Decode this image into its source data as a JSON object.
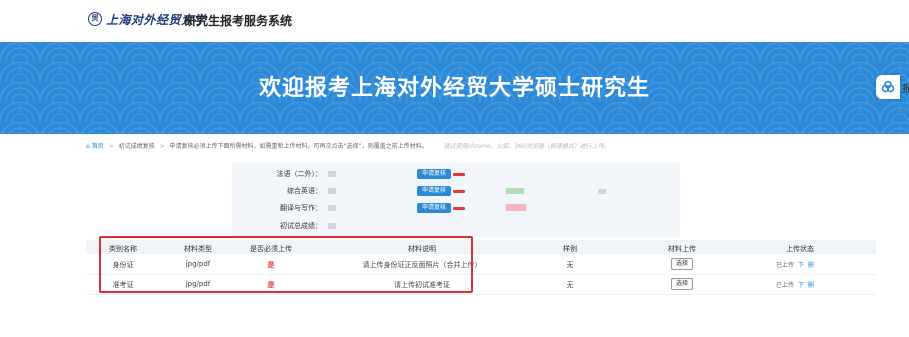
{
  "header": {
    "logo_seal": "贸",
    "logo_name": "上海对外经贸大学",
    "system_title": "研究生报考服务系统"
  },
  "banner": {
    "title": "欢迎报考上海对外经贸大学硕士研究生",
    "bg_color": "#2c89d8"
  },
  "float_button": {
    "icon": "cloud-icon",
    "label": "报"
  },
  "breadcrumb": {
    "home": "首页",
    "current": "初试成绩复核",
    "instruction": "申请复核必须上传下面所需材料，如需重新上传材料，可再次点击“选择”，则覆盖之前上传材料。",
    "tip": "建议使用chrome、火狐、360浏览器（极速模式）进行上传。"
  },
  "scores": [
    {
      "label": "法语（二外）：",
      "button": "申请复核"
    },
    {
      "label": "综合英语：",
      "button": "申请复核"
    },
    {
      "label": "翻译与写作：",
      "button": "申请复核"
    },
    {
      "label": "初试总成绩："
    }
  ],
  "table": {
    "headers": [
      "类别名称",
      "材料类型",
      "是否必须上传",
      "材料说明",
      "样例",
      "材料上传",
      "上传状态"
    ],
    "rows": [
      {
        "name": "身份证",
        "type": "jpg/pdf",
        "required": "是",
        "desc": "请上传身份证正反面照片（合并上传）",
        "sample": "无",
        "upload": "选择",
        "status": "已上传",
        "download": "下",
        "delete": "删"
      },
      {
        "name": "准考证",
        "type": "jpg/pdf",
        "required": "是",
        "desc": "请上传初试准考证",
        "sample": "无",
        "upload": "选择",
        "status": "已上传",
        "download": "下",
        "delete": "删"
      }
    ]
  },
  "colors": {
    "accent": "#2c89d8",
    "required": "#e23a3a",
    "highlight": "#e03030"
  }
}
